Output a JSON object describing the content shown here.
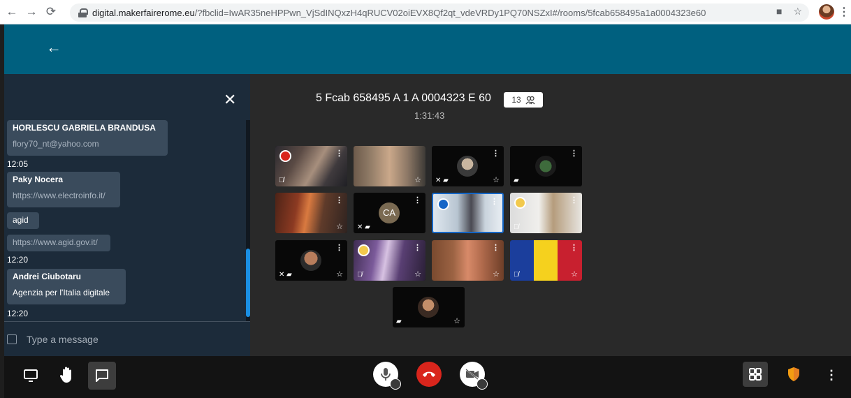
{
  "browser": {
    "url_host": "digital.makerfairerome.eu",
    "url_rest": "/?fbclid=IwAR35neHPPwn_VjSdINQxzH4qRUCV02oiEVX8Qf2qt_vdeVRDy1PQ70NSZxI#/rooms/5fcab658495a1a0004323e60"
  },
  "chat": {
    "messages": [
      {
        "name": "HORLESCU GABRIELA BRANDUSA",
        "text": "flory70_nt@yahoo.com",
        "time": "12:05"
      },
      {
        "name": "Paky Nocera",
        "text": "https://www.electroinfo.it/"
      },
      {
        "text": "agid"
      },
      {
        "text": "https://www.agid.gov.it/",
        "time": "12:20"
      },
      {
        "name": "Andrei Ciubotaru",
        "text": "Agenzia per l'Italia digitale",
        "time": "12:20"
      }
    ],
    "input_placeholder": "Type a message"
  },
  "room": {
    "title": "5 Fcab 658495 A 1 A 0004323 E 60",
    "participant_count": "13",
    "timer": "1:31:43"
  },
  "tiles": [
    {
      "kind": "video",
      "indicator": "red"
    },
    {
      "kind": "video"
    },
    {
      "kind": "avatar"
    },
    {
      "kind": "avatar"
    },
    {
      "kind": "video"
    },
    {
      "kind": "initials",
      "initials": "CA"
    },
    {
      "kind": "video",
      "indicator": "blue",
      "active": true
    },
    {
      "kind": "video",
      "indicator": "yellow"
    },
    {
      "kind": "avatar"
    },
    {
      "kind": "video",
      "indicator": "yellow"
    },
    {
      "kind": "video"
    },
    {
      "kind": "video"
    },
    {
      "kind": "avatar"
    }
  ],
  "colors": {
    "header": "#00607f",
    "chat_panel": "#1c2b3a",
    "stage": "#292929",
    "hangup": "#d9251c",
    "security_shield": "#f39c12",
    "active_speaker": "#1566c5"
  }
}
